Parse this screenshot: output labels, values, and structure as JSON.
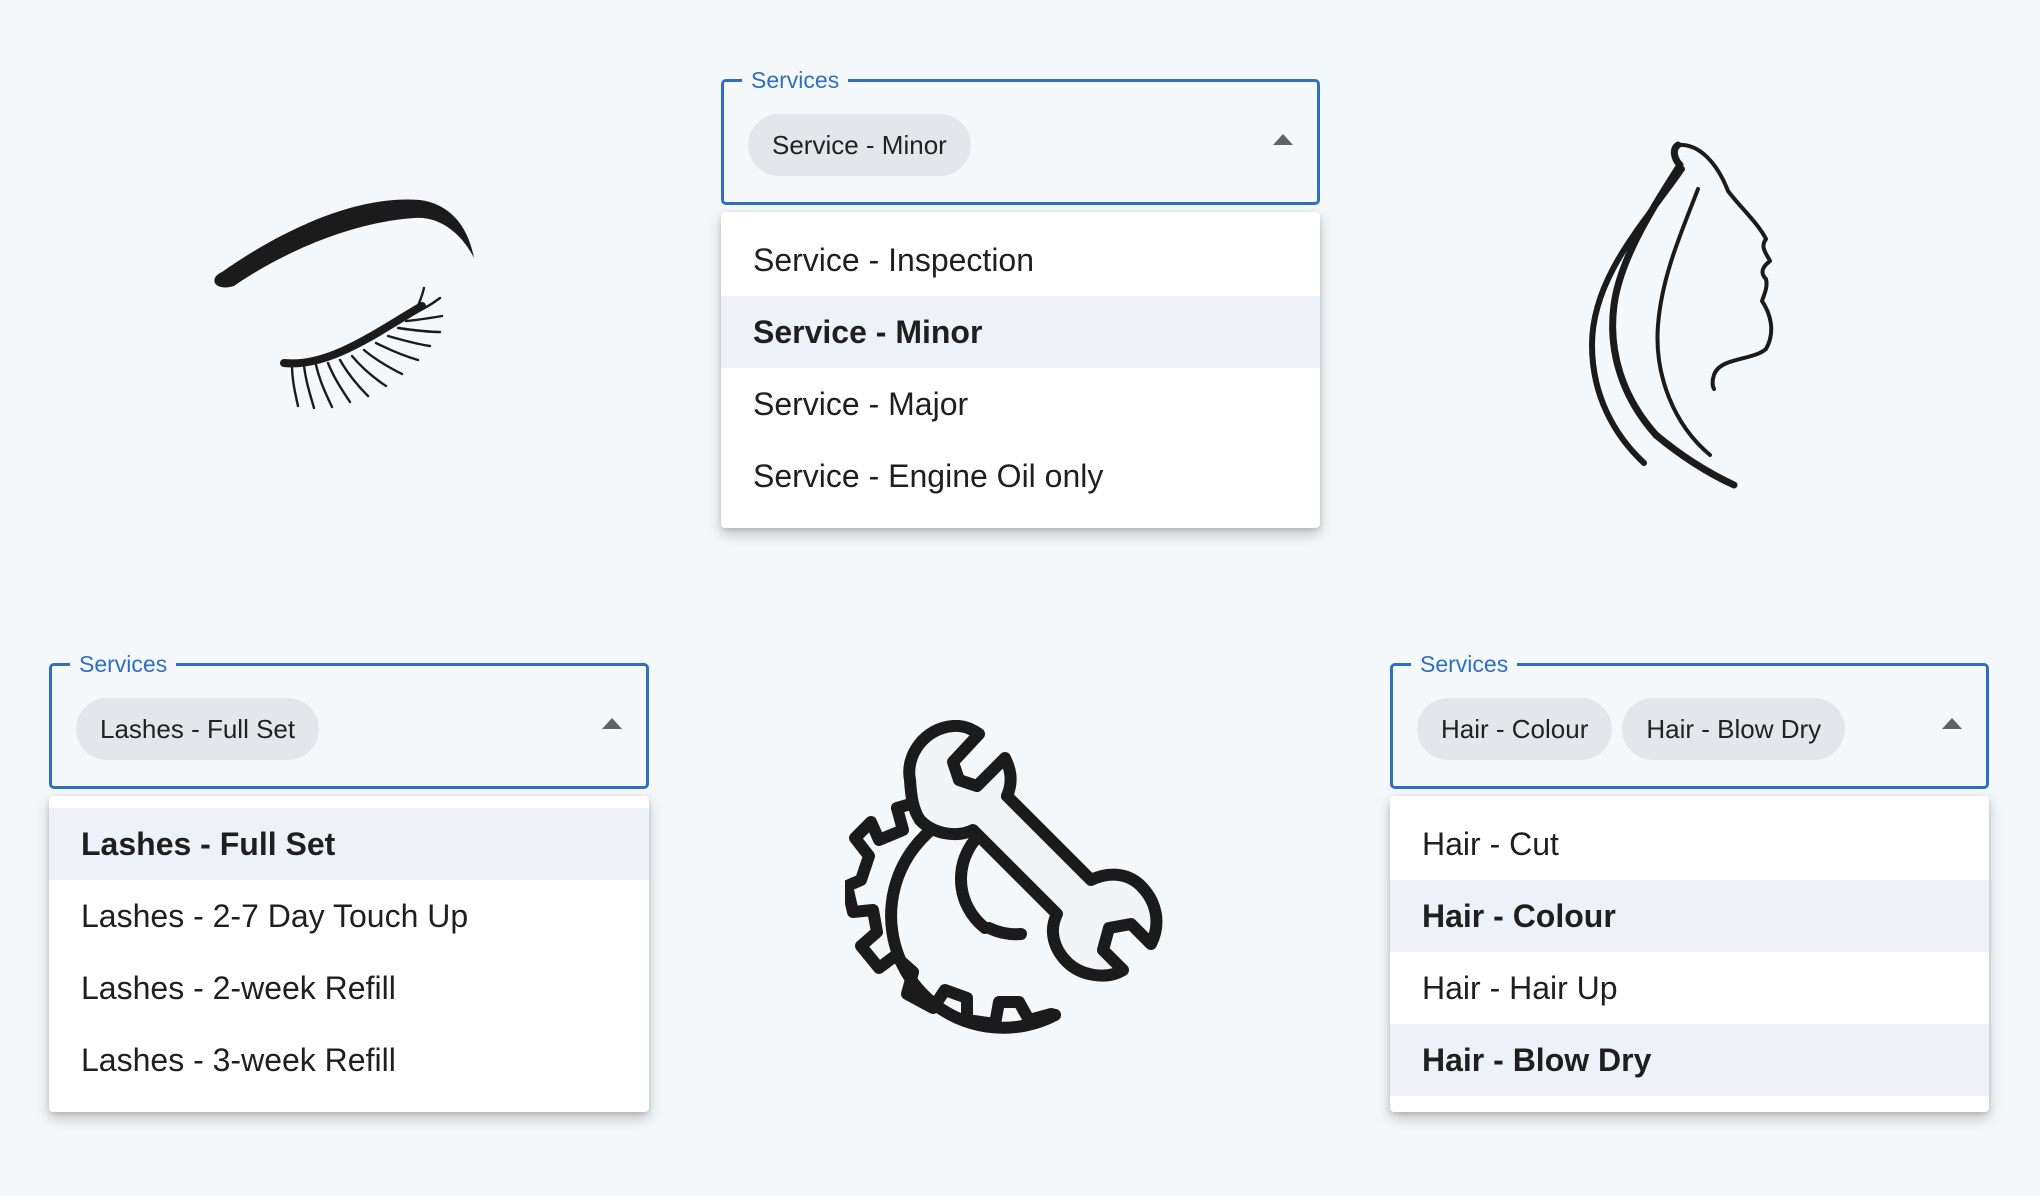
{
  "top_select": {
    "label": "Services",
    "chips": [
      "Service - Minor"
    ],
    "options": [
      {
        "label": "Service - Inspection",
        "selected": false
      },
      {
        "label": "Service - Minor",
        "selected": true
      },
      {
        "label": "Service - Major",
        "selected": false
      },
      {
        "label": "Service - Engine Oil only",
        "selected": false
      }
    ]
  },
  "left_select": {
    "label": "Services",
    "chips": [
      "Lashes - Full Set"
    ],
    "options": [
      {
        "label": "Lashes - Full Set",
        "selected": true
      },
      {
        "label": "Lashes - 2-7 Day Touch Up",
        "selected": false
      },
      {
        "label": "Lashes - 2-week Refill",
        "selected": false
      },
      {
        "label": "Lashes - 3-week Refill",
        "selected": false
      }
    ]
  },
  "right_select": {
    "label": "Services",
    "chips": [
      "Hair - Colour",
      "Hair - Blow Dry"
    ],
    "options": [
      {
        "label": "Hair - Cut",
        "selected": false
      },
      {
        "label": "Hair - Colour",
        "selected": true
      },
      {
        "label": "Hair - Hair Up",
        "selected": false
      },
      {
        "label": "Hair - Blow Dry",
        "selected": true
      }
    ]
  },
  "icons": {
    "eyelash": "closed-eye-lashes-icon",
    "face": "woman-face-profile-icon",
    "gear_wrench": "gear-wrench-icon"
  },
  "colors": {
    "accent": "#2f6fc0",
    "background": "#f5f8fb",
    "chip": "#e3e6ea",
    "selected_item": "#eef2f8"
  }
}
